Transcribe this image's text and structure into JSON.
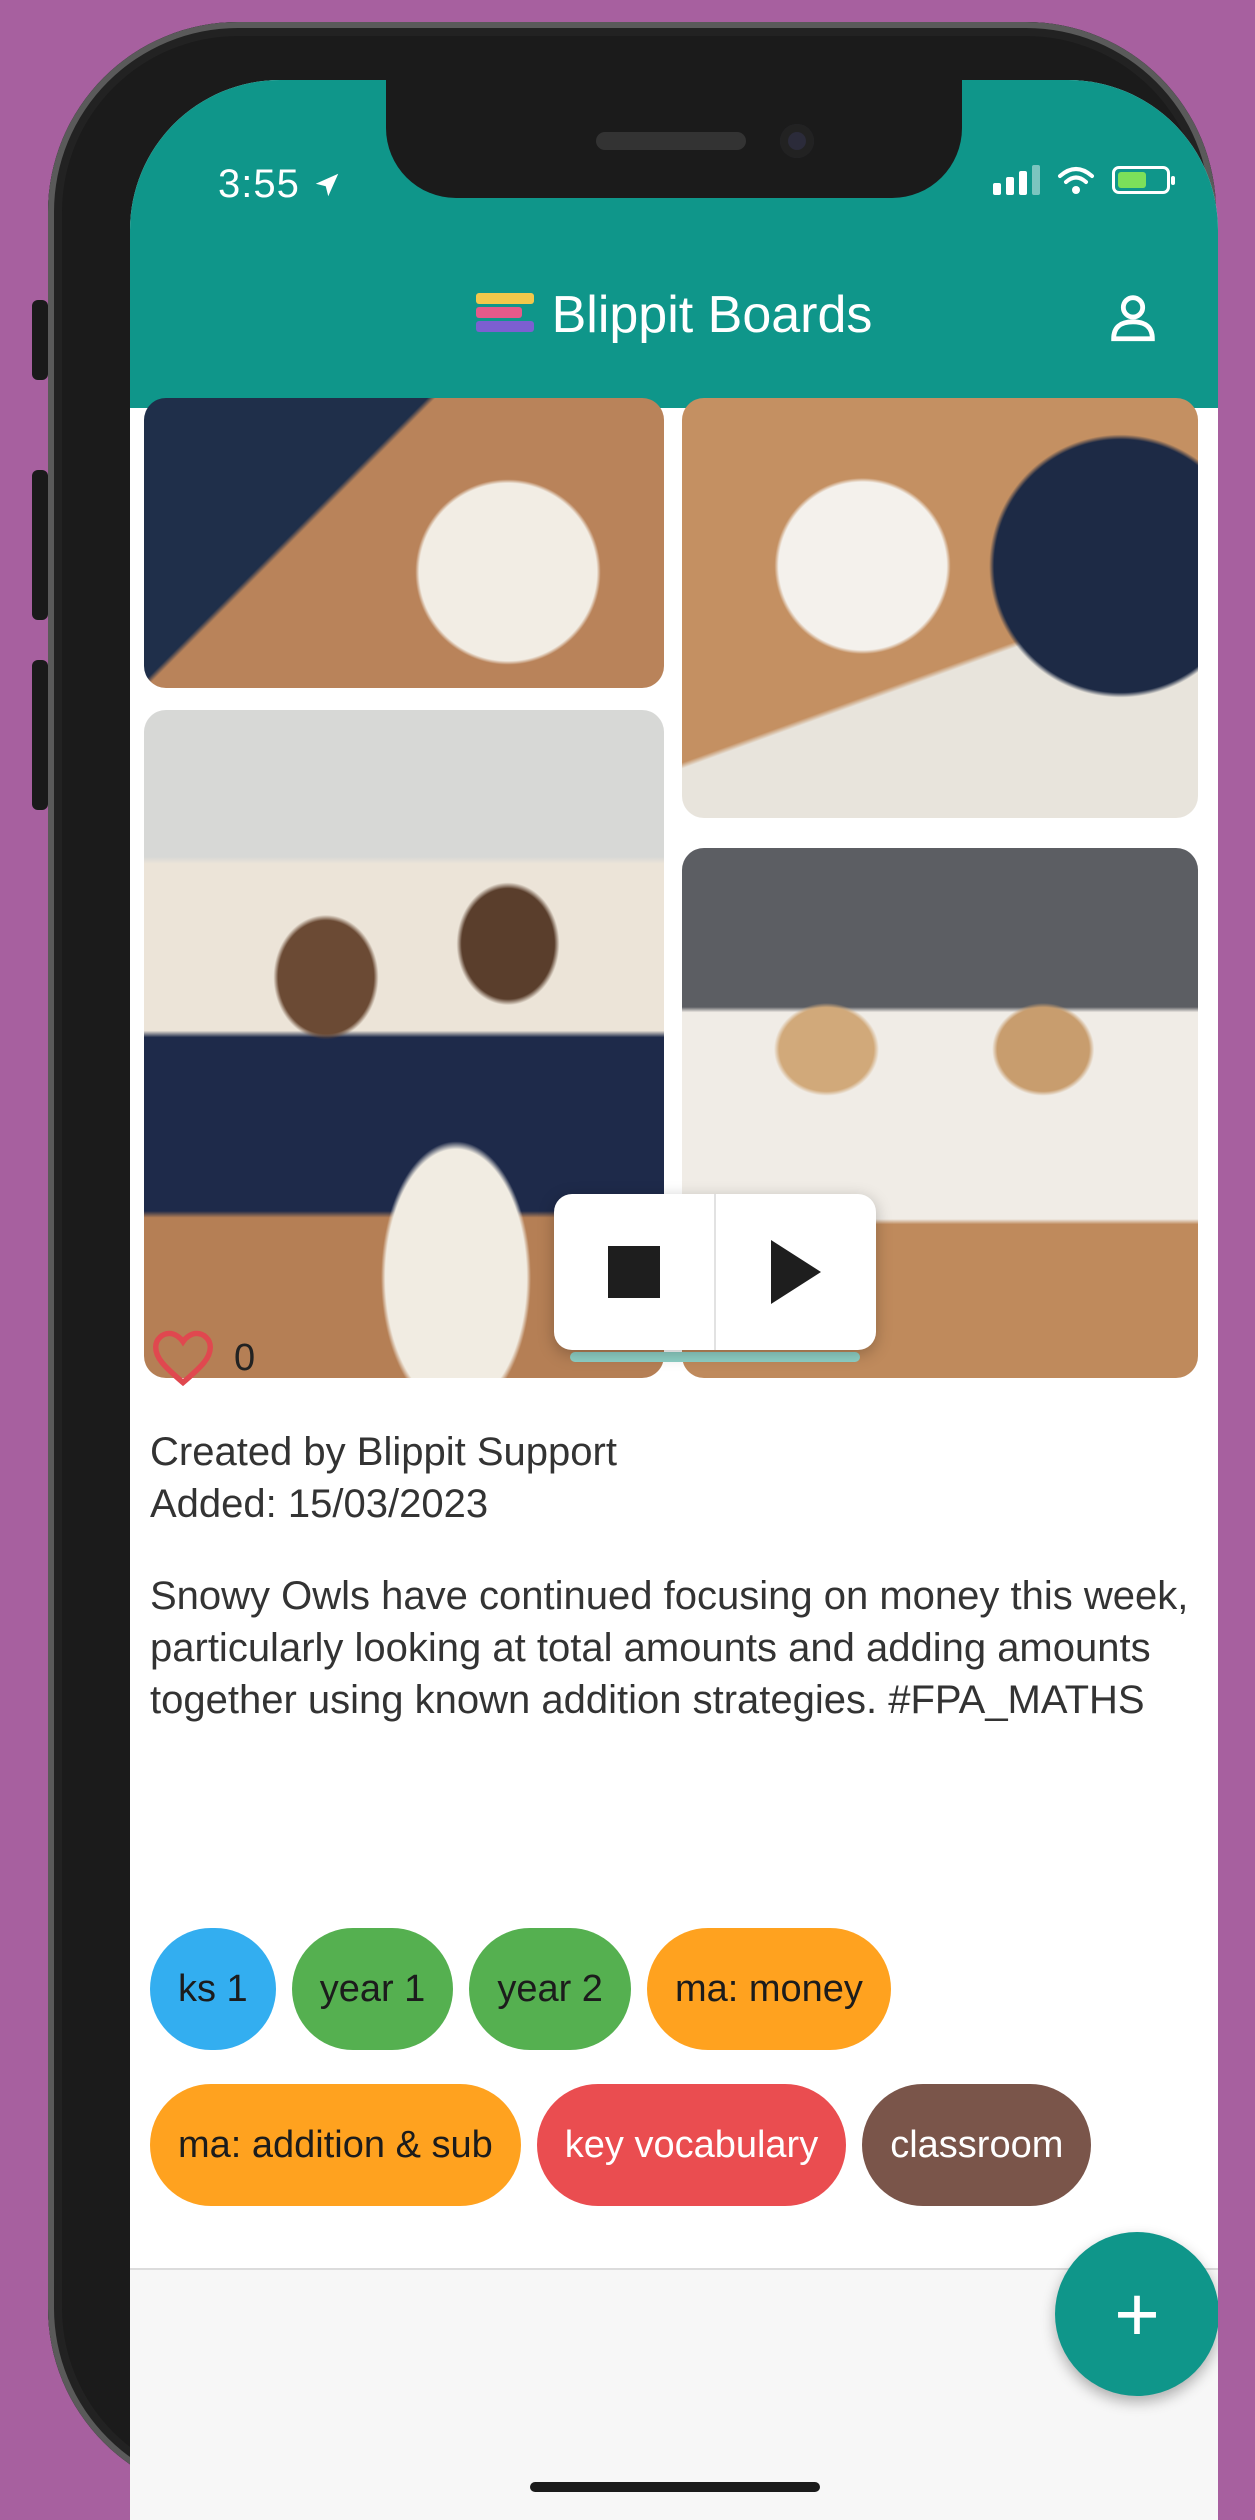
{
  "status_bar": {
    "time": "3:55"
  },
  "app_bar": {
    "title": "Blippit Boards"
  },
  "post": {
    "like_count": "0",
    "created_by": "Created by Blippit Support",
    "added": "Added: 15/03/2023",
    "description": "Snowy Owls have continued focusing on money this week, particularly looking at total amounts and adding amounts together using known addition strategies. #FPA_MATHS",
    "tags_row1": [
      {
        "label": "ks 1",
        "color": "#33aef0"
      },
      {
        "label": "year 1",
        "color": "#55b050"
      },
      {
        "label": "year 2",
        "color": "#55b050"
      },
      {
        "label": "ma: money",
        "color": "#ffa21f"
      }
    ],
    "tags_row2": [
      {
        "label": "ma: addition & sub",
        "color": "#ffa21f"
      },
      {
        "label": "key vocabulary",
        "color": "#ea4d50"
      },
      {
        "label": "classroom",
        "color": "#7a554a"
      }
    ]
  },
  "fab": {
    "label": "+"
  },
  "colors": {
    "primary": "#0f968a",
    "background": "#a7609f",
    "heart": "#e0484f"
  },
  "icons": [
    "location-arrow-icon",
    "signal-icon",
    "wifi-icon",
    "battery-charging-icon",
    "app-logo-icon",
    "profile-icon",
    "stop-icon",
    "play-icon",
    "heart-icon",
    "plus-icon"
  ]
}
